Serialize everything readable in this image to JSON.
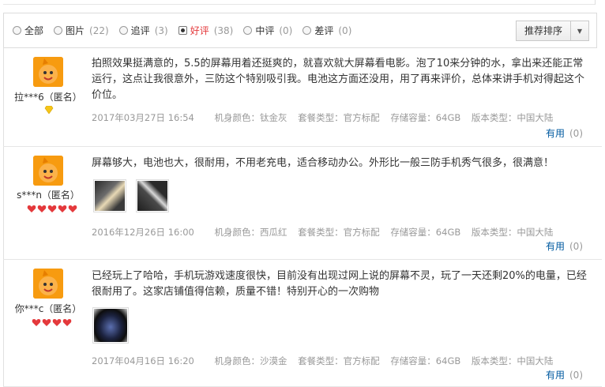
{
  "filters": [
    {
      "label": "全部",
      "count": ""
    },
    {
      "label": "图片",
      "count": "(22)"
    },
    {
      "label": "追评",
      "count": "(3)"
    },
    {
      "label": "好评",
      "count": "(38)"
    },
    {
      "label": "中评",
      "count": "(0)"
    },
    {
      "label": "差评",
      "count": "(0)"
    }
  ],
  "sort": {
    "label": "推荐排序"
  },
  "reviews": [
    {
      "user": "拉***6（匿名）",
      "text": "拍照效果挺满意的，5.5的屏幕用着还挺爽的，就喜欢就大屏幕看电影。泡了10来分钟的水，拿出来还能正常运行，这点让我很意外，三防这个特别吸引我。电池这方面还没用，用了再来评价，总体来讲手机对得起这个价位。",
      "date": "2017年03月27日 16:54",
      "color": "机身颜色：钛金灰",
      "package": "套餐类型：官方标配",
      "storage": "存储容量：64GB",
      "version": "版本类型：中国大陆",
      "useful_label": "有用",
      "useful_count": "(0)"
    },
    {
      "user": "s***n（匿名）",
      "text": "屏幕够大，电池也大，很耐用，不用老充电，适合移动办公。外形比一般三防手机秀气很多，很满意！",
      "date": "2016年12月26日 16:00",
      "color": "机身颜色：西瓜红",
      "package": "套餐类型：官方标配",
      "storage": "存储容量：64GB",
      "version": "版本类型：中国大陆",
      "useful_label": "有用",
      "useful_count": "(0)"
    },
    {
      "user": "你***c（匿名）",
      "text": "已经玩上了哈哈，手机玩游戏速度很快，目前没有出现过网上说的屏幕不灵，玩了一天还剩20%的电量，已经很耐用了。这家店铺值得信赖，质量不错！特别开心的一次购物",
      "date": "2017年04月16日 16:20",
      "color": "机身颜色：沙漠金",
      "package": "套餐类型：官方标配",
      "storage": "存储容量：64GB",
      "version": "版本类型：中国大陆",
      "useful_label": "有用",
      "useful_count": "(0)"
    }
  ],
  "colors": {
    "accent": "#e4393c",
    "link": "#005aa0",
    "avatar": "#f79b10",
    "muted": "#999999"
  }
}
